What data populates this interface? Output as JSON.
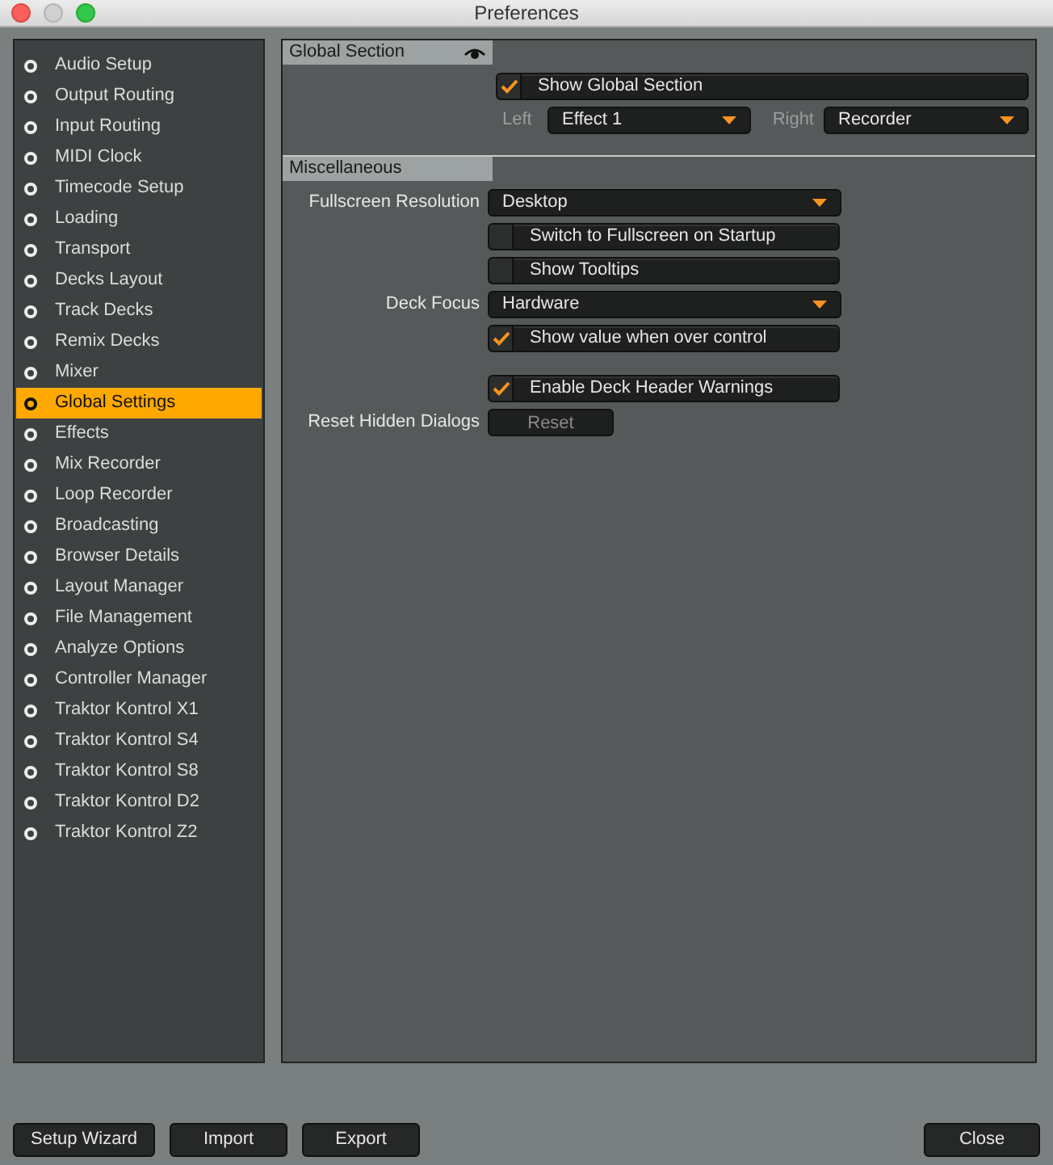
{
  "window": {
    "title": "Preferences"
  },
  "sidebar": {
    "items": [
      {
        "label": "Audio Setup",
        "selected": false
      },
      {
        "label": "Output Routing",
        "selected": false
      },
      {
        "label": "Input Routing",
        "selected": false
      },
      {
        "label": "MIDI Clock",
        "selected": false
      },
      {
        "label": "Timecode Setup",
        "selected": false
      },
      {
        "label": "Loading",
        "selected": false
      },
      {
        "label": "Transport",
        "selected": false
      },
      {
        "label": "Decks Layout",
        "selected": false
      },
      {
        "label": "Track Decks",
        "selected": false
      },
      {
        "label": "Remix Decks",
        "selected": false
      },
      {
        "label": "Mixer",
        "selected": false
      },
      {
        "label": "Global Settings",
        "selected": true
      },
      {
        "label": "Effects",
        "selected": false
      },
      {
        "label": "Mix Recorder",
        "selected": false
      },
      {
        "label": "Loop Recorder",
        "selected": false
      },
      {
        "label": "Broadcasting",
        "selected": false
      },
      {
        "label": "Browser Details",
        "selected": false
      },
      {
        "label": "Layout Manager",
        "selected": false
      },
      {
        "label": "File Management",
        "selected": false
      },
      {
        "label": "Analyze Options",
        "selected": false
      },
      {
        "label": "Controller Manager",
        "selected": false
      },
      {
        "label": "Traktor Kontrol X1",
        "selected": false
      },
      {
        "label": "Traktor Kontrol S4",
        "selected": false
      },
      {
        "label": "Traktor Kontrol S8",
        "selected": false
      },
      {
        "label": "Traktor Kontrol D2",
        "selected": false
      },
      {
        "label": "Traktor Kontrol Z2",
        "selected": false
      }
    ]
  },
  "global_section": {
    "title": "Global Section",
    "show_checkbox": {
      "text": "Show Global Section",
      "checked": true
    },
    "left": {
      "label": "Left",
      "value": "Effect 1"
    },
    "right": {
      "label": "Right",
      "value": "Recorder"
    }
  },
  "miscellaneous": {
    "title": "Miscellaneous",
    "groups": [
      [
        {
          "kind": "dropdown",
          "label": "Fullscreen Resolution",
          "value": "Desktop"
        },
        {
          "kind": "checkbox",
          "text": "Switch to Fullscreen on Startup",
          "checked": false
        },
        {
          "kind": "checkbox",
          "text": "Show Tooltips",
          "checked": false
        },
        {
          "kind": "dropdown",
          "label": "Deck Focus",
          "value": "Hardware"
        },
        {
          "kind": "checkbox",
          "text": "Show value when over control",
          "checked": true
        }
      ],
      [
        {
          "kind": "checkbox",
          "text": "Enable Deck Header Warnings",
          "checked": true
        },
        {
          "kind": "button",
          "label": "Reset Hidden Dialogs",
          "text": "Reset",
          "disabled": true
        }
      ]
    ]
  },
  "footer": {
    "left_buttons": [
      "Setup Wizard",
      "Import",
      "Export"
    ],
    "close": "Close"
  }
}
